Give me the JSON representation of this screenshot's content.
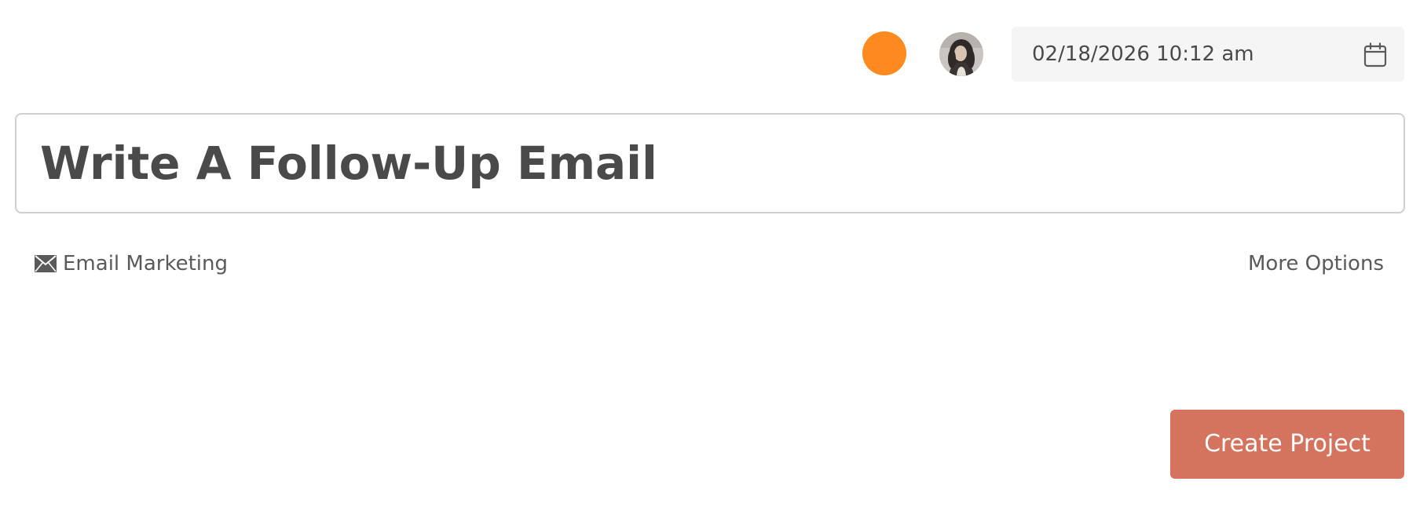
{
  "header": {
    "color_swatch": {
      "color": "#ff8a1f"
    },
    "avatar": {
      "icon": "user-avatar-icon"
    },
    "due_date": {
      "value": "02/18/2026 10:12 am",
      "icon": "calendar-icon"
    }
  },
  "title": {
    "value": "Write A Follow-Up Email"
  },
  "category": {
    "icon": "envelope-icon",
    "label": "Email Marketing"
  },
  "more_options_label": "More Options",
  "create_button": {
    "label": "Create Project",
    "color": "#d4735e"
  }
}
